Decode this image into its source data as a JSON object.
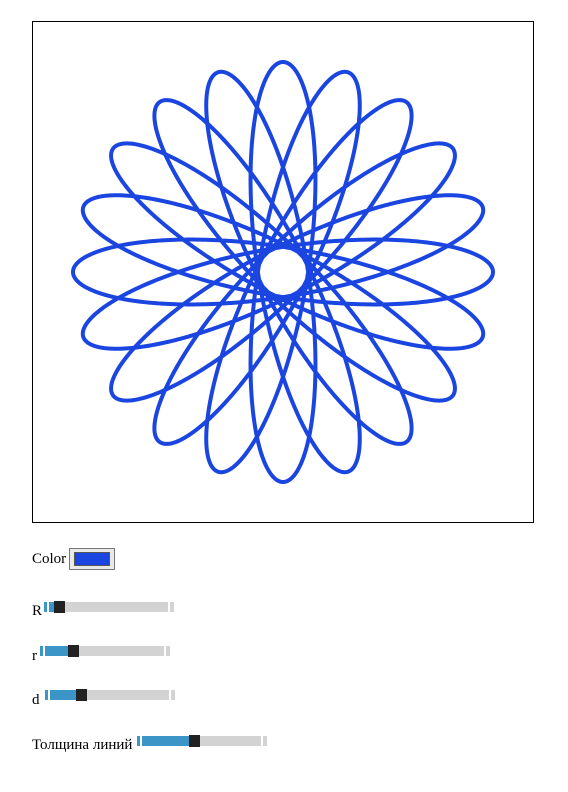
{
  "canvas": {
    "description_colors": {
      "stroke": "#1a45e0",
      "background": "#ffffff",
      "border": "#000000"
    },
    "curve": {
      "type": "hypotrochoid",
      "lobes": 20
    }
  },
  "controls": {
    "color": {
      "label": "Color",
      "value": "#1a45e0"
    },
    "R": {
      "label": "R",
      "value_fraction": 0.06,
      "fill_color": "#3b95c6"
    },
    "r": {
      "label": "r",
      "value_fraction": 0.22,
      "fill_color": "#3b95c6"
    },
    "d": {
      "label": "d",
      "value_fraction": 0.25,
      "fill_color": "#3b95c6"
    },
    "line_width": {
      "label": "Толщина линий",
      "value_fraction": 0.43,
      "fill_color": "#3b95c6"
    }
  }
}
